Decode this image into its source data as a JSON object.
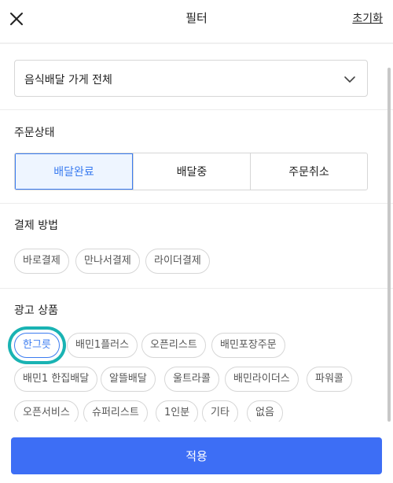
{
  "header": {
    "title": "필터",
    "reset_label": "초기화",
    "close_icon": "close-icon"
  },
  "store_select": {
    "value": "음식배달 가게 전체",
    "icon": "chevron-down-icon"
  },
  "order_status": {
    "title": "주문상태",
    "options": [
      "배달완료",
      "배달중",
      "주문취소"
    ],
    "selected": "배달완료"
  },
  "payment": {
    "title": "결제 방법",
    "options": [
      "바로결제",
      "만나서결제",
      "라이더결제"
    ]
  },
  "ad_products": {
    "title": "광고 상품",
    "row1": [
      "한그릇",
      "배민1플러스",
      "오픈리스트",
      "배민포장주문"
    ],
    "row2": [
      "배민1 한집배달",
      "알뜰배달",
      "울트라콜",
      "배민라이더스",
      "파워콜"
    ],
    "row3": [
      "오픈서비스",
      "슈퍼리스트",
      "1인분",
      "기타",
      "없음"
    ],
    "selected": "한그릇"
  },
  "footer": {
    "apply_label": "적용"
  },
  "colors": {
    "accent": "#3b7cf0",
    "apply_button": "#3d6ef5",
    "highlight_ring": "#19b3b3"
  }
}
